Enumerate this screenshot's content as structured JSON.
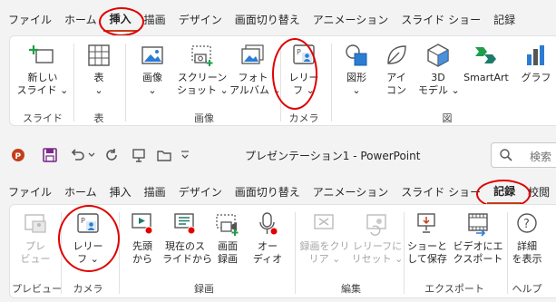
{
  "top_ribbon": {
    "tabs": [
      "ファイル",
      "ホーム",
      "挿入",
      "描画",
      "デザイン",
      "画面切り替え",
      "アニメーション",
      "スライド ショー",
      "記録"
    ],
    "active_tab": "挿入",
    "commands": {
      "new_slide": [
        "新しい",
        "スライド ⌄"
      ],
      "table": [
        "表",
        "⌄"
      ],
      "image": [
        "画像",
        "⌄"
      ],
      "screenshot": [
        "スクリーン",
        "ショット ⌄"
      ],
      "photo_album": [
        "フォト",
        "アルバム ⌄"
      ],
      "cameo": [
        "レリー",
        "フ ⌄"
      ],
      "shapes": [
        "図形",
        "⌄"
      ],
      "icons": [
        "アイ",
        "コン"
      ],
      "models3d": [
        "3D",
        "モデル ⌄"
      ],
      "smartart": [
        "SmartArt"
      ],
      "graph": [
        "グラフ"
      ]
    },
    "groups": {
      "slides": "スライド",
      "table": "表",
      "images": "画像",
      "camera": "カメラ",
      "illustrations": "図"
    }
  },
  "bottom_ribbon": {
    "app_title": "プレゼンテーション1  -  PowerPoint",
    "search_placeholder": "検索",
    "tabs": [
      "ファイル",
      "ホーム",
      "挿入",
      "描画",
      "デザイン",
      "画面切り替え",
      "アニメーション",
      "スライド ショー",
      "記録",
      "校閲"
    ],
    "active_tab": "記録",
    "commands": {
      "preview": [
        "プレ",
        "ビュー"
      ],
      "cameo": [
        "レリー",
        "フ ⌄"
      ],
      "from_start": [
        "先頭",
        "から"
      ],
      "from_current": [
        "現在のス",
        "ライドから"
      ],
      "screen_record": [
        "画面",
        "録画"
      ],
      "audio": [
        "オー",
        "ディオ"
      ],
      "clear_recording": [
        "録画をクリ",
        "リア ⌄"
      ],
      "reset_cameo": [
        "レリーフに",
        "リセット ⌄"
      ],
      "save_show": [
        "ショーと",
        "して保存"
      ],
      "export_video": [
        "ビデオにエ",
        "クスポート"
      ],
      "show_details": [
        "詳細",
        "を表示"
      ]
    },
    "groups": {
      "preview": "プレビュー",
      "camera": "カメラ",
      "recording": "録画",
      "edit": "編集",
      "export": "エクスポート",
      "help": "ヘルプ"
    }
  },
  "colors": {
    "accent_red": "#c43e1c",
    "annotation_red": "#e00000",
    "icon_blue": "#2b7cd3",
    "icon_teal": "#1e7b6a"
  }
}
